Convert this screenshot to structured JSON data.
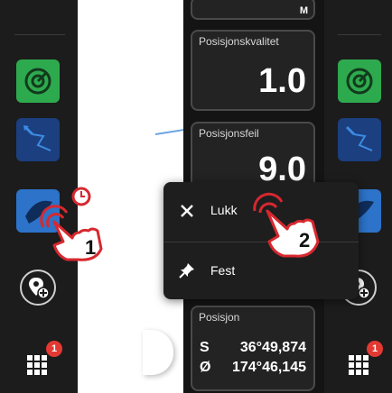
{
  "left_rail": {
    "icons": [
      "radar-icon",
      "route-icon",
      "navigation-icon",
      "add-waypoint-icon",
      "apps-grid-icon"
    ],
    "apps_badge": "1"
  },
  "data_tiles": [
    {
      "label": "",
      "value": "",
      "unit": "M"
    },
    {
      "label": "Posisjonskvalitet",
      "value": "1.0"
    },
    {
      "label": "Posisjonsfeil",
      "value": "9.0"
    },
    {
      "label": "Posisjon",
      "lat_hemi": "S",
      "lat": "36°49,874",
      "lon_hemi": "Ø",
      "lon": "174°46,145"
    }
  ],
  "context_menu": {
    "close_label": "Lukk",
    "pin_label": "Fest"
  },
  "steps": {
    "first": "1",
    "second": "2"
  },
  "right_rail": {
    "apps_badge": "1"
  },
  "colors": {
    "accent_green": "#2eaa4e",
    "accent_blue": "#2c73c9",
    "badge_red": "#e23a33",
    "highlight_red": "#d7282f"
  }
}
